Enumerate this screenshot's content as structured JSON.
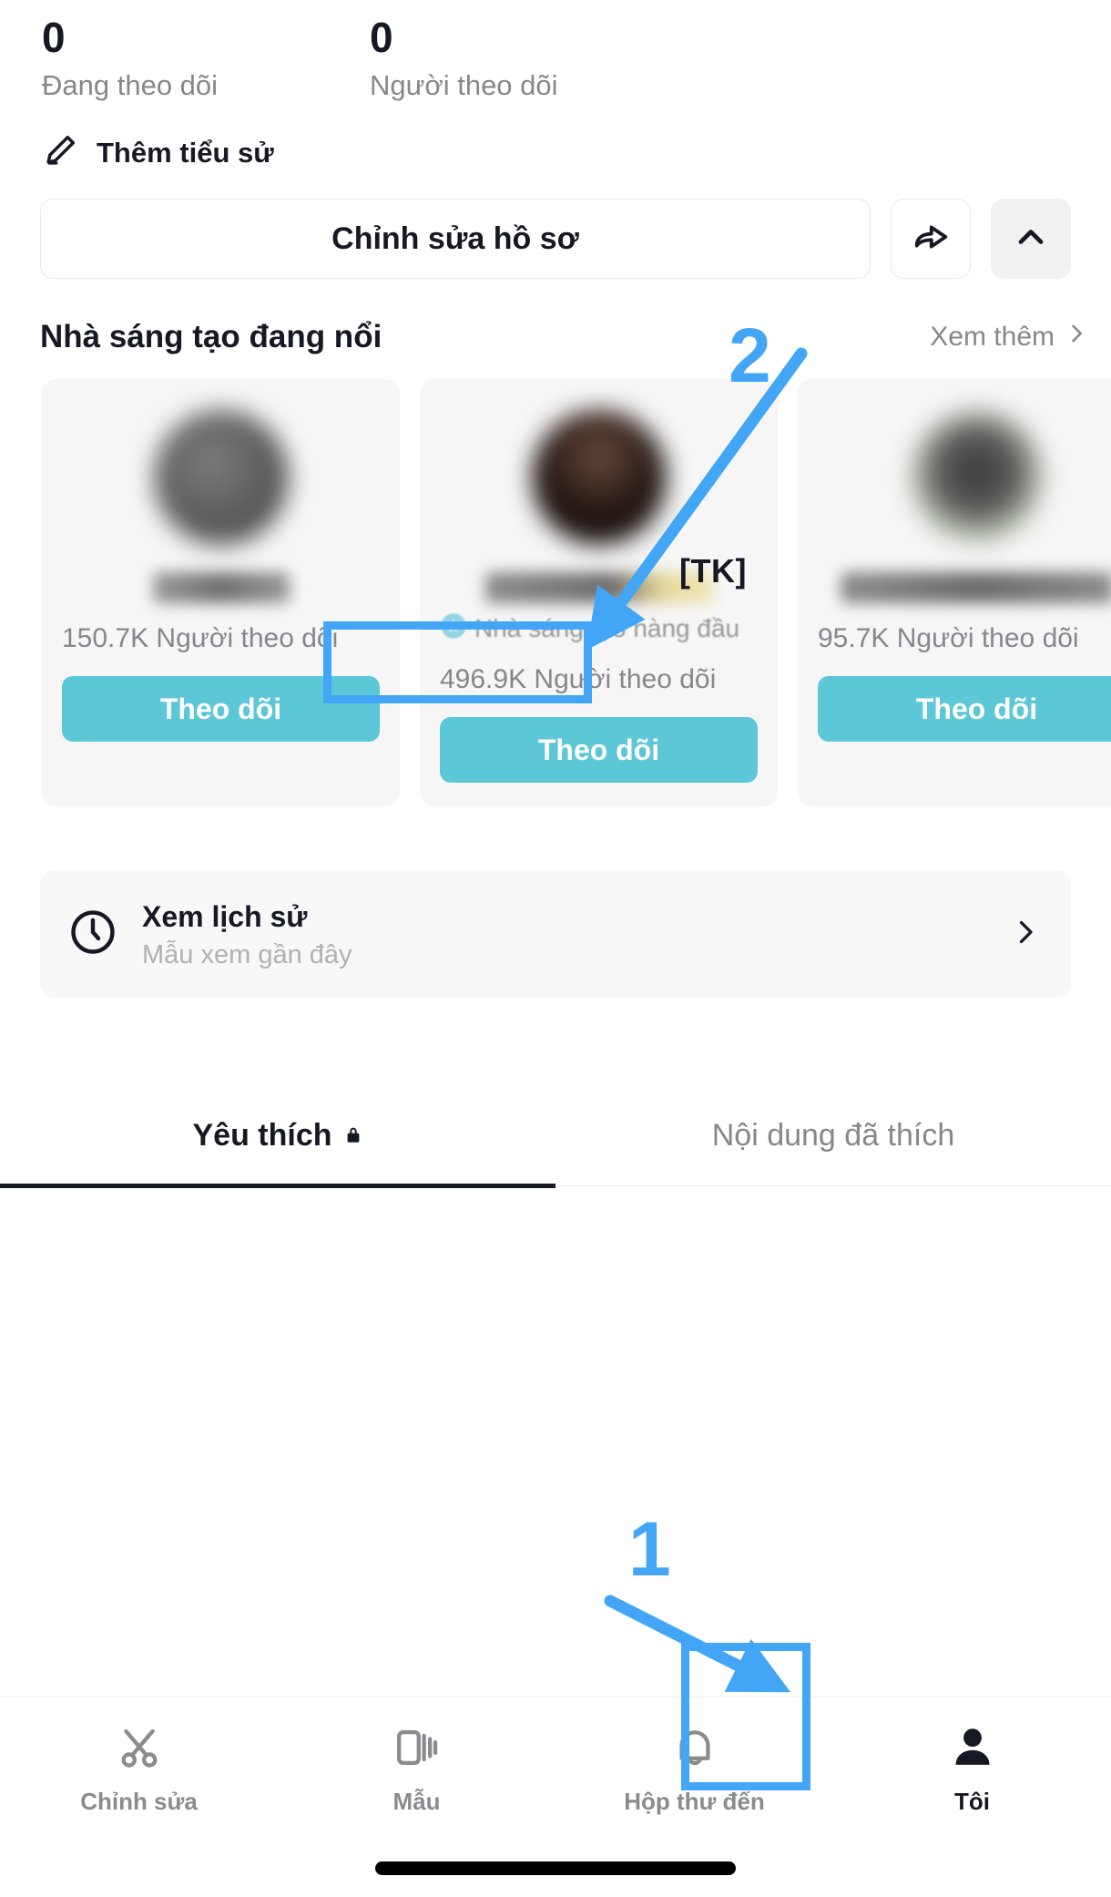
{
  "profile_stats": [
    {
      "value": "0",
      "label": "Đang theo dõi"
    },
    {
      "value": "0",
      "label": "Người theo dõi"
    }
  ],
  "add_bio": {
    "label": "Thêm tiểu sử",
    "icon": "pencil-icon"
  },
  "actions": {
    "edit_profile_label": "Chỉnh sửa hồ sơ",
    "share_icon": "share-arrow-icon",
    "collapse_icon": "chevron-up-icon"
  },
  "creators_section": {
    "title": "Nhà sáng tạo đang nổi",
    "see_more_label": "Xem thêm",
    "see_more_icon": "chevron-right-icon",
    "follow_button_label": "Theo dõi",
    "top_creator_badge_label": "Nhà sáng tạo hàng đầu",
    "cards": [
      {
        "name_redacted": true,
        "tk_tag": "",
        "verified": false,
        "followers": "150.7K Người theo dõi",
        "follow_label": "Theo dõi"
      },
      {
        "name_redacted": true,
        "tk_tag": "[TK]",
        "verified": true,
        "badge_label": "Nhà sáng tạo hàng đầu",
        "followers": "496.9K Người theo dõi",
        "follow_label": "Theo dõi"
      },
      {
        "name_redacted": true,
        "tk_tag": "",
        "verified": false,
        "followers": "95.7K Người theo dõi",
        "follow_label": "Theo dõi"
      }
    ]
  },
  "history": {
    "icon": "clock-icon",
    "title": "Xem lịch sử",
    "subtitle": "Mẫu xem gần đây",
    "chevron_icon": "chevron-right-icon"
  },
  "tabs": [
    {
      "label": "Yêu thích",
      "icon": "lock-icon",
      "active": true
    },
    {
      "label": "Nội dung đã thích",
      "icon": "",
      "active": false
    }
  ],
  "bottom_nav": [
    {
      "label": "Chỉnh sửa",
      "icon": "scissors-icon",
      "active": false
    },
    {
      "label": "Mẫu",
      "icon": "templates-icon",
      "active": false
    },
    {
      "label": "Hộp thư đến",
      "icon": "bell-icon",
      "active": false
    },
    {
      "label": "Tôi",
      "icon": "person-icon",
      "active": true
    }
  ],
  "annotations": {
    "color": "#42a5f5",
    "step_one": "1",
    "step_two": "2"
  },
  "colors": {
    "accent_teal": "#5cc7d7",
    "annotation_blue": "#42a5f5",
    "text_primary": "#161823",
    "text_secondary": "#86878b"
  }
}
